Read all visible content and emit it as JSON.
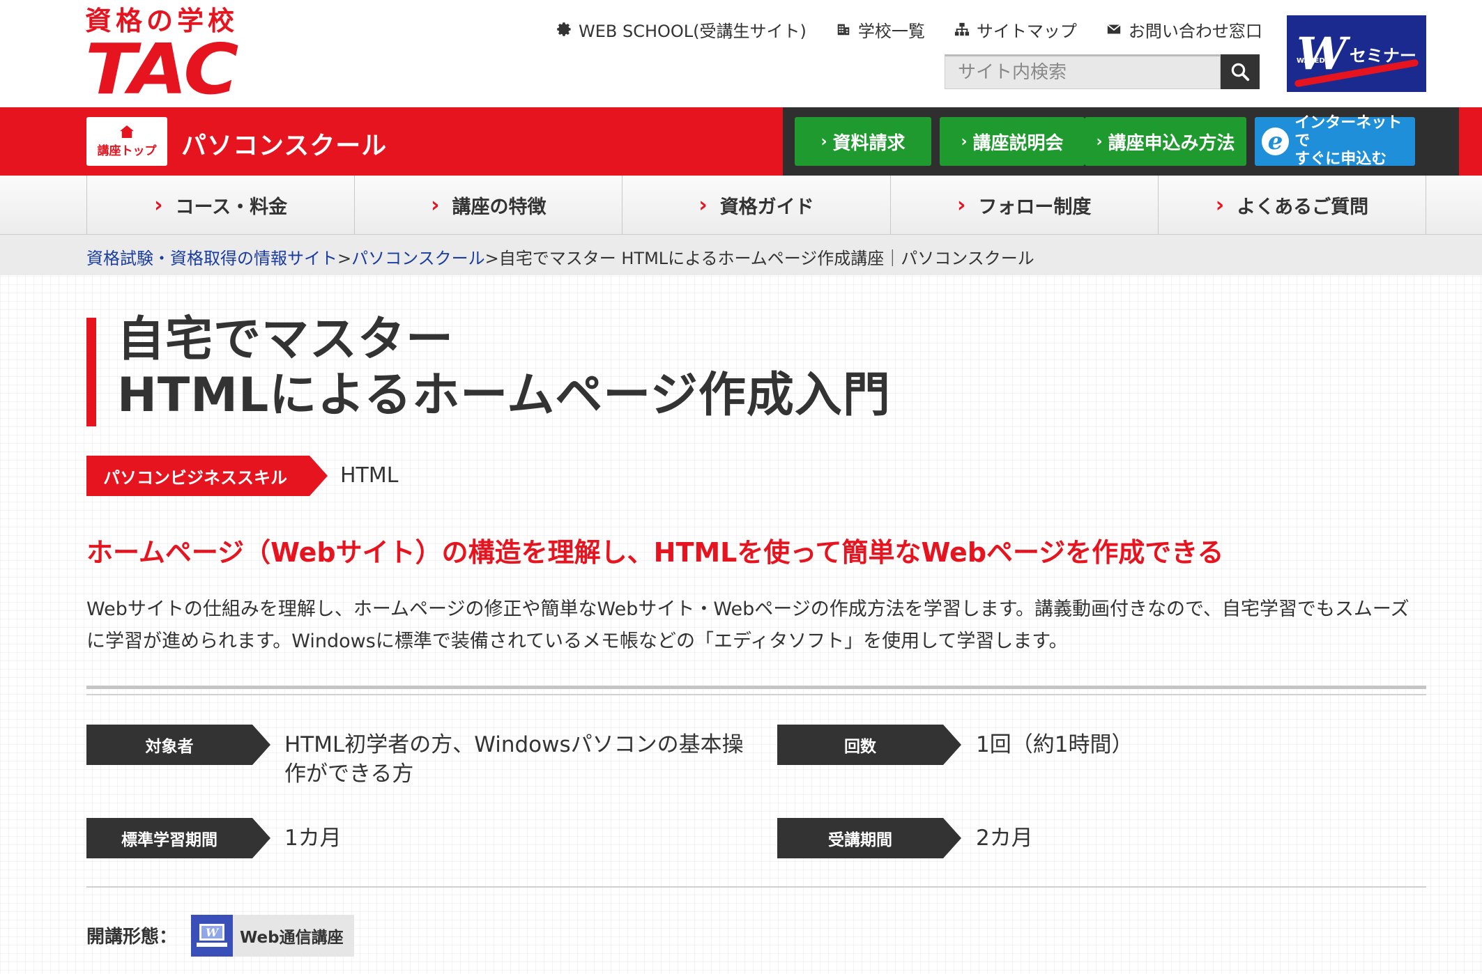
{
  "header": {
    "logo_sub": "資格の学校",
    "logo_main": "TAC",
    "top_links": [
      {
        "label": "WEB SCHOOL(受講生サイト)",
        "icon": "gear-icon"
      },
      {
        "label": "学校一覧",
        "icon": "building-icon"
      },
      {
        "label": "サイトマップ",
        "icon": "sitemap-icon"
      },
      {
        "label": "お問い合わせ窓口",
        "icon": "mail-icon"
      }
    ],
    "search_placeholder": "サイト内検索",
    "partner_logo_text": "セミナー",
    "partner_logo_sub": "WASEDA"
  },
  "band": {
    "course_top_label": "講座トップ",
    "school_name": "パソコンスクール",
    "cta": [
      {
        "label": "資料請求"
      },
      {
        "label": "講座説明会"
      },
      {
        "label": "講座申込み方法"
      }
    ],
    "internet_cta_line1": "インターネットで",
    "internet_cta_line2": "すぐに申込む"
  },
  "nav": {
    "items": [
      "コース・料金",
      "講座の特徴",
      "資格ガイド",
      "フォロー制度",
      "よくあるご質問"
    ]
  },
  "breadcrumb": {
    "crumb1": "資格試験・資格取得の情報サイト",
    "crumb2": "パソコンスクール",
    "sep": ">",
    "current": "自宅でマスター HTMLによるホームページ作成講座｜パソコンスクール"
  },
  "main": {
    "title_line1": "自宅でマスター",
    "title_line2": "HTMLによるホームページ作成入門",
    "category": "パソコンビジネススキル",
    "category_sub": "HTML",
    "lead": "ホームページ（Webサイト）の構造を理解し、HTMLを使って簡単なWebページを作成できる",
    "description": "Webサイトの仕組みを理解し、ホームページの修正や簡単なWebサイト・Webページの作成方法を学習します。講義動画付きなので、自宅学習でもスムーズに学習が進められます。Windowsに標準で装備されているメモ帳などの「エディタソフト」を使用して学習します。"
  },
  "spec": {
    "target_label": "対象者",
    "target_value": "HTML初学者の方、Windowsパソコンの基本操作ができる方",
    "sessions_label": "回数",
    "sessions_value": "1回（約1時間）",
    "period_label": "標準学習期間",
    "period_value": "1カ月",
    "access_label": "受講期間",
    "access_value": "2カ月"
  },
  "format": {
    "label": "開講形態：",
    "badge": "Web通信講座"
  },
  "colors": {
    "brand_red": "#e6141f",
    "cta_green": "#1f9a2e",
    "cta_blue": "#1f8fd9",
    "dark": "#333333",
    "link_blue": "#1a3c9e"
  }
}
